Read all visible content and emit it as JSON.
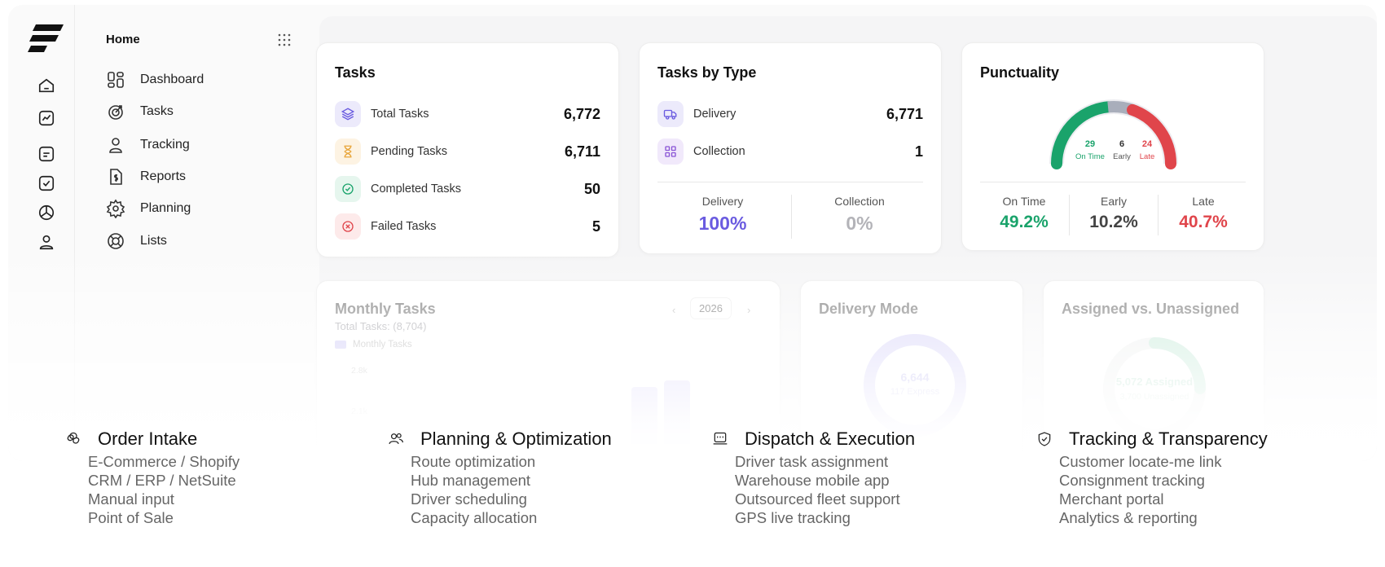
{
  "sidebar": {
    "title": "Home",
    "items": [
      {
        "label": "Dashboard",
        "icon": "dashboard-icon"
      },
      {
        "label": "Tasks",
        "icon": "target-icon"
      },
      {
        "label": "Tracking",
        "icon": "user-icon"
      },
      {
        "label": "Reports",
        "icon": "dollar-doc-icon"
      },
      {
        "label": "Planning",
        "icon": "gear-icon"
      },
      {
        "label": "Lists",
        "icon": "lifebuoy-icon"
      }
    ]
  },
  "tasks_card": {
    "title": "Tasks",
    "rows": [
      {
        "label": "Total Tasks",
        "value": "6,772",
        "icon": "layers-icon"
      },
      {
        "label": "Pending Tasks",
        "value": "6,711",
        "icon": "hourglass-icon"
      },
      {
        "label": "Completed Tasks",
        "value": "50",
        "icon": "check-circle-icon"
      },
      {
        "label": "Failed Tasks",
        "value": "5",
        "icon": "x-circle-icon"
      }
    ]
  },
  "type_card": {
    "title": "Tasks by Type",
    "rows": [
      {
        "label": "Delivery",
        "value": "6,771",
        "icon": "truck-icon"
      },
      {
        "label": "Collection",
        "value": "1",
        "icon": "grid-icon"
      }
    ],
    "stats": [
      {
        "label": "Delivery",
        "value": "100%"
      },
      {
        "label": "Collection",
        "value": "0%"
      }
    ]
  },
  "punctuality_card": {
    "title": "Punctuality",
    "gauge": {
      "on_time_count": "29",
      "on_time_label": "On Time",
      "early_count": "6",
      "early_label": "Early",
      "late_count": "24",
      "late_label": "Late"
    },
    "stats": [
      {
        "label": "On Time",
        "value": "49.2%"
      },
      {
        "label": "Early",
        "value": "10.2%"
      },
      {
        "label": "Late",
        "value": "40.7%"
      }
    ]
  },
  "monthly_card": {
    "title": "Monthly Tasks",
    "subtitle": "Total Tasks: (8,704)",
    "year": "2026",
    "legend": "Monthly Tasks",
    "ticks": [
      "2.8k",
      "2.1k"
    ]
  },
  "delivery_mode_card": {
    "title": "Delivery Mode",
    "center_value": "6,644",
    "center_label": "117 Express"
  },
  "assigned_card": {
    "title": "Assigned vs. Unassigned",
    "center_value": "5,072 Assigned",
    "center_label": "3,700 Unassigned"
  },
  "features": [
    {
      "title": "Order Intake",
      "icon": "openai-knot-icon",
      "items": [
        "E-Commerce / Shopify",
        "CRM / ERP / NetSuite",
        "Manual input",
        "Point of Sale"
      ]
    },
    {
      "title": "Planning & Optimization",
      "icon": "users-icon",
      "items": [
        "Route optimization",
        "Hub management",
        "Driver scheduling",
        "Capacity allocation"
      ]
    },
    {
      "title": "Dispatch & Execution",
      "icon": "terminal-icon",
      "items": [
        "Driver task assignment",
        "Warehouse mobile app",
        "Outsourced fleet support",
        "GPS live tracking"
      ]
    },
    {
      "title": "Tracking & Transparency",
      "icon": "shield-check-icon",
      "items": [
        "Customer locate-me link",
        "Consignment tracking",
        "Merchant portal",
        "Analytics & reporting"
      ]
    }
  ],
  "colors": {
    "accent": "#6a5be0",
    "green": "#1aa36b",
    "red": "#e0454b",
    "muted": "#9a9aa0"
  }
}
